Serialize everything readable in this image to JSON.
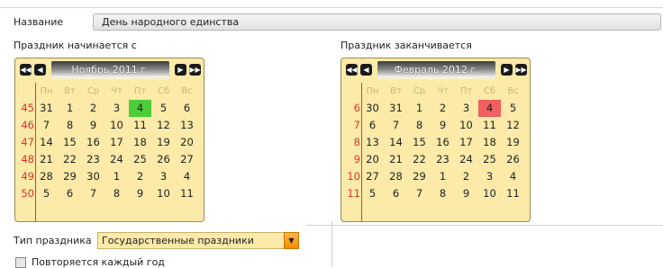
{
  "name_label": "Название",
  "name_value": "День народного единства",
  "start_label": "Праздник начинается с",
  "end_label": "Праздник заканчивается",
  "weekday_headers": [
    "Пн",
    "Вт",
    "Ср",
    "Чт",
    "Пт",
    "Сб",
    "Вс"
  ],
  "start_calendar": {
    "month_title": "Ноябрь 2011 г.",
    "week_numbers": [
      "45",
      "46",
      "47",
      "48",
      "49",
      "50"
    ],
    "weeks": [
      [
        "31",
        "1",
        "2",
        "3",
        "4",
        "5",
        "6"
      ],
      [
        "7",
        "8",
        "9",
        "10",
        "11",
        "12",
        "13"
      ],
      [
        "14",
        "15",
        "16",
        "17",
        "18",
        "19",
        "20"
      ],
      [
        "21",
        "22",
        "23",
        "24",
        "25",
        "26",
        "27"
      ],
      [
        "28",
        "29",
        "30",
        "1",
        "2",
        "3",
        "4"
      ],
      [
        "5",
        "6",
        "7",
        "8",
        "9",
        "10",
        "11"
      ]
    ],
    "selected_color": "#4ccd3a"
  },
  "end_calendar": {
    "month_title": "Февраль 2012 г.",
    "week_numbers": [
      "6",
      "7",
      "8",
      "9",
      "10",
      "11"
    ],
    "weeks": [
      [
        "30",
        "31",
        "1",
        "2",
        "3",
        "4",
        "5"
      ],
      [
        "6",
        "7",
        "8",
        "9",
        "10",
        "11",
        "12"
      ],
      [
        "13",
        "14",
        "15",
        "16",
        "17",
        "18",
        "19"
      ],
      [
        "20",
        "21",
        "22",
        "23",
        "24",
        "25",
        "26"
      ],
      [
        "27",
        "28",
        "29",
        "1",
        "2",
        "3",
        "4"
      ],
      [
        "5",
        "6",
        "7",
        "8",
        "9",
        "10",
        "11"
      ]
    ],
    "selected_color": "#f06060"
  },
  "type_label": "Тип праздника",
  "type_value": "Государственные праздники",
  "repeat_label": "Повторяется каждый год",
  "nav_icons": [
    "first-icon",
    "prev-icon",
    "next-icon",
    "last-icon"
  ]
}
